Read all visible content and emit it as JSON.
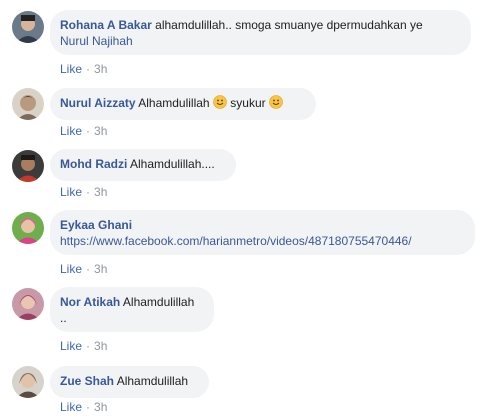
{
  "comments": [
    {
      "author": "Rohana A Bakar",
      "text": "alhamdulillah.. smoga smuanye dpermudahkan ye",
      "mention": "Nurul Najihah",
      "like_label": "Like",
      "time": "3h"
    },
    {
      "author": "Nurul Aizzaty",
      "text_part1": "Alhamdulillah",
      "text_part2": "syukur",
      "like_label": "Like",
      "time": "3h"
    },
    {
      "author": "Mohd Radzi",
      "text": "Alhamdulillah....",
      "like_label": "Like",
      "time": "3h"
    },
    {
      "author": "Eykaa Ghani",
      "link": "https://www.facebook.com/harianmetro/videos/487180755470446/",
      "like_label": "Like",
      "time": "3h"
    },
    {
      "author": "Nor Atikah",
      "text": "Alhamdulillah",
      "text_line2": "..",
      "like_label": "Like",
      "time": "3h"
    },
    {
      "author": "Zue Shah",
      "text": "Alhamdulillah",
      "like_label": "Like",
      "time": "3h"
    }
  ],
  "colors": {
    "author": "#385898",
    "bubble": "#f2f3f5",
    "meta": "#90949c",
    "like": "#4267b2"
  },
  "icons": {
    "emoji": "smiling-face-emoji"
  }
}
